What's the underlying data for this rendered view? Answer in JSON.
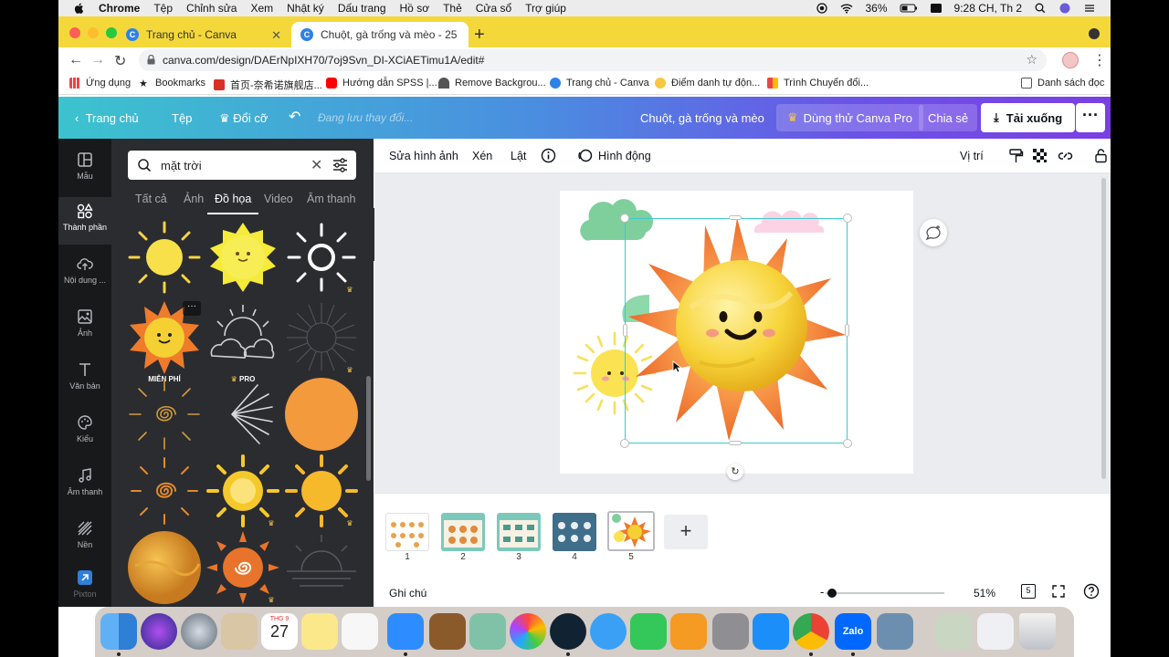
{
  "menubar": {
    "items": [
      "Chrome",
      "Tệp",
      "Chỉnh sửa",
      "Xem",
      "Nhật ký",
      "Dấu trang",
      "Hồ sơ",
      "Thẻ",
      "Cửa sổ",
      "Trợ giúp"
    ],
    "battery": "36%",
    "clock": "9:28 CH, Th 2"
  },
  "browser": {
    "tabs": [
      {
        "title": "Trang chủ - Canva",
        "active": false
      },
      {
        "title": "Chuột, gà trống và mèo - 25 ×",
        "active": true
      }
    ],
    "url": "canva.com/design/DAErNpIXH70/7oj9Svn_DI-XCiAETimu1A/edit#",
    "bookmarks": [
      "Ứng dụng",
      "Bookmarks",
      "首页-奈希诺旗舰店...",
      "Hướng dẫn SPSS |...",
      "Remove Backgrou...",
      "Trang chủ - Canva",
      "Điểm danh tự độn...",
      "Trình Chuyển đổi...",
      "Danh sách đọc"
    ]
  },
  "canva_header": {
    "home": "Trang chủ",
    "file": "Tệp",
    "resize": "Đổi cỡ",
    "saving": "Đang lưu thay đổi...",
    "design_title": "Chuột, gà trống và mèo",
    "try_pro": "Dùng thử Canva Pro",
    "share": "Chia sẻ",
    "download": "Tải xuống"
  },
  "rail": [
    "Mẫu",
    "Thành phần",
    "Nội dung ...",
    "Ảnh",
    "Văn bản",
    "Kiểu",
    "Âm thanh",
    "Nền",
    "Pixton"
  ],
  "panel": {
    "search_value": "mặt trời",
    "subtabs": [
      "Tất cả",
      "Ảnh",
      "Đồ họa",
      "Video",
      "Âm thanh"
    ],
    "badge_free": "MIỄN PHÍ",
    "badge_pro": "PRO"
  },
  "toolbar": {
    "edit_image": "Sửa hình ảnh",
    "crop": "Xén",
    "flip": "Lật",
    "animate": "Hình động",
    "position": "Vị trí"
  },
  "pages": [
    "1",
    "2",
    "3",
    "4",
    "5"
  ],
  "footer": {
    "notes": "Ghi chú",
    "zoom": "51%",
    "page_count": "5"
  },
  "dock": {
    "calendar_month": "THG 9",
    "calendar_day": "27",
    "zalo": "Zalo"
  },
  "colors": {
    "canva_gradient_start": "#3cc3ce",
    "canva_gradient_end": "#7b3fe4",
    "selection": "#3ec9cf",
    "chrome_tab_strip": "#f4d83a"
  }
}
